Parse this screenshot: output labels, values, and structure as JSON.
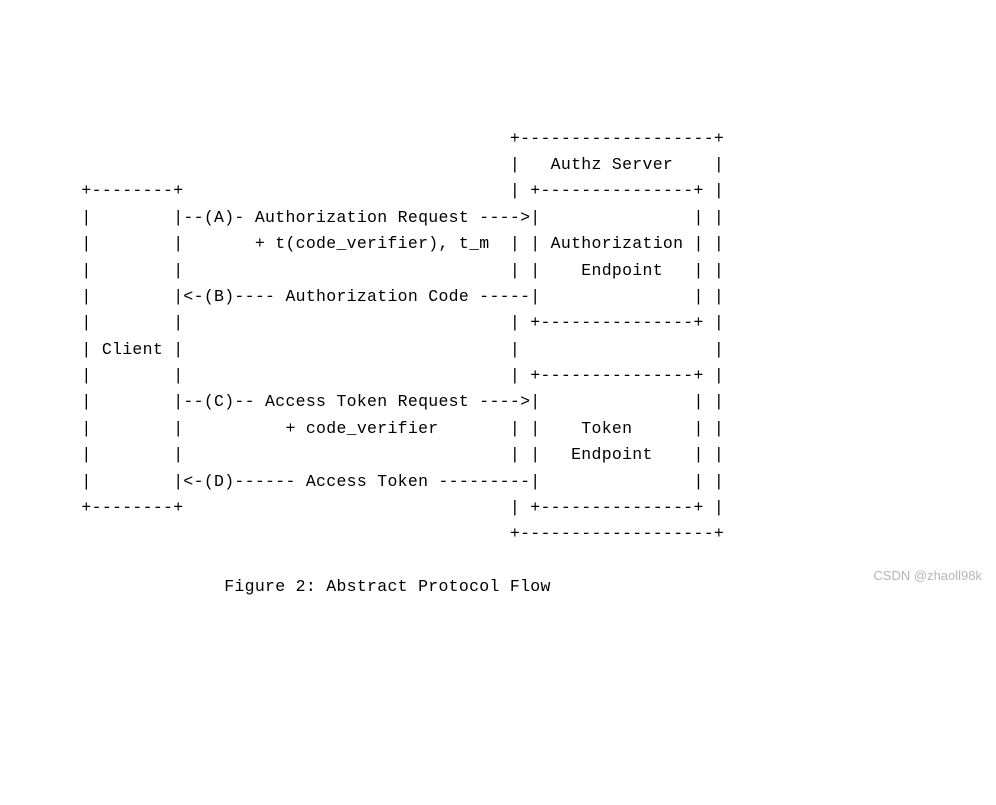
{
  "diagram": {
    "lines": [
      "                                                 +-------------------+",
      "                                                 |   Authz Server    |",
      "       +--------+                                | +---------------+ |",
      "       |        |--(A)- Authorization Request ---->|               | |",
      "       |        |       + t(code_verifier), t_m  | | Authorization | |",
      "       |        |                                | |    Endpoint   | |",
      "       |        |<-(B)---- Authorization Code -----|               | |",
      "       |        |                                | +---------------+ |",
      "       | Client |                                |                   |",
      "       |        |                                | +---------------+ |",
      "       |        |--(C)-- Access Token Request ---->|               | |",
      "       |        |          + code_verifier       | |    Token      | |",
      "       |        |                                | |   Endpoint    | |",
      "       |        |<-(D)------ Access Token ---------|               | |",
      "       +--------+                                | +---------------+ |",
      "                                                 +-------------------+",
      "",
      "                     Figure 2: Abstract Protocol Flow"
    ],
    "entities": {
      "client": "Client",
      "server": "Authz Server",
      "authorization_endpoint": "Authorization Endpoint",
      "token_endpoint": "Token Endpoint"
    },
    "flows": {
      "A": {
        "label": "Authorization Request",
        "params": "+ t(code_verifier), t_m",
        "direction": "client-to-server"
      },
      "B": {
        "label": "Authorization Code",
        "direction": "server-to-client"
      },
      "C": {
        "label": "Access Token Request",
        "params": "+ code_verifier",
        "direction": "client-to-server"
      },
      "D": {
        "label": "Access Token",
        "direction": "server-to-client"
      }
    },
    "caption": "Figure 2: Abstract Protocol Flow"
  },
  "watermark": "CSDN @zhaoll98k"
}
